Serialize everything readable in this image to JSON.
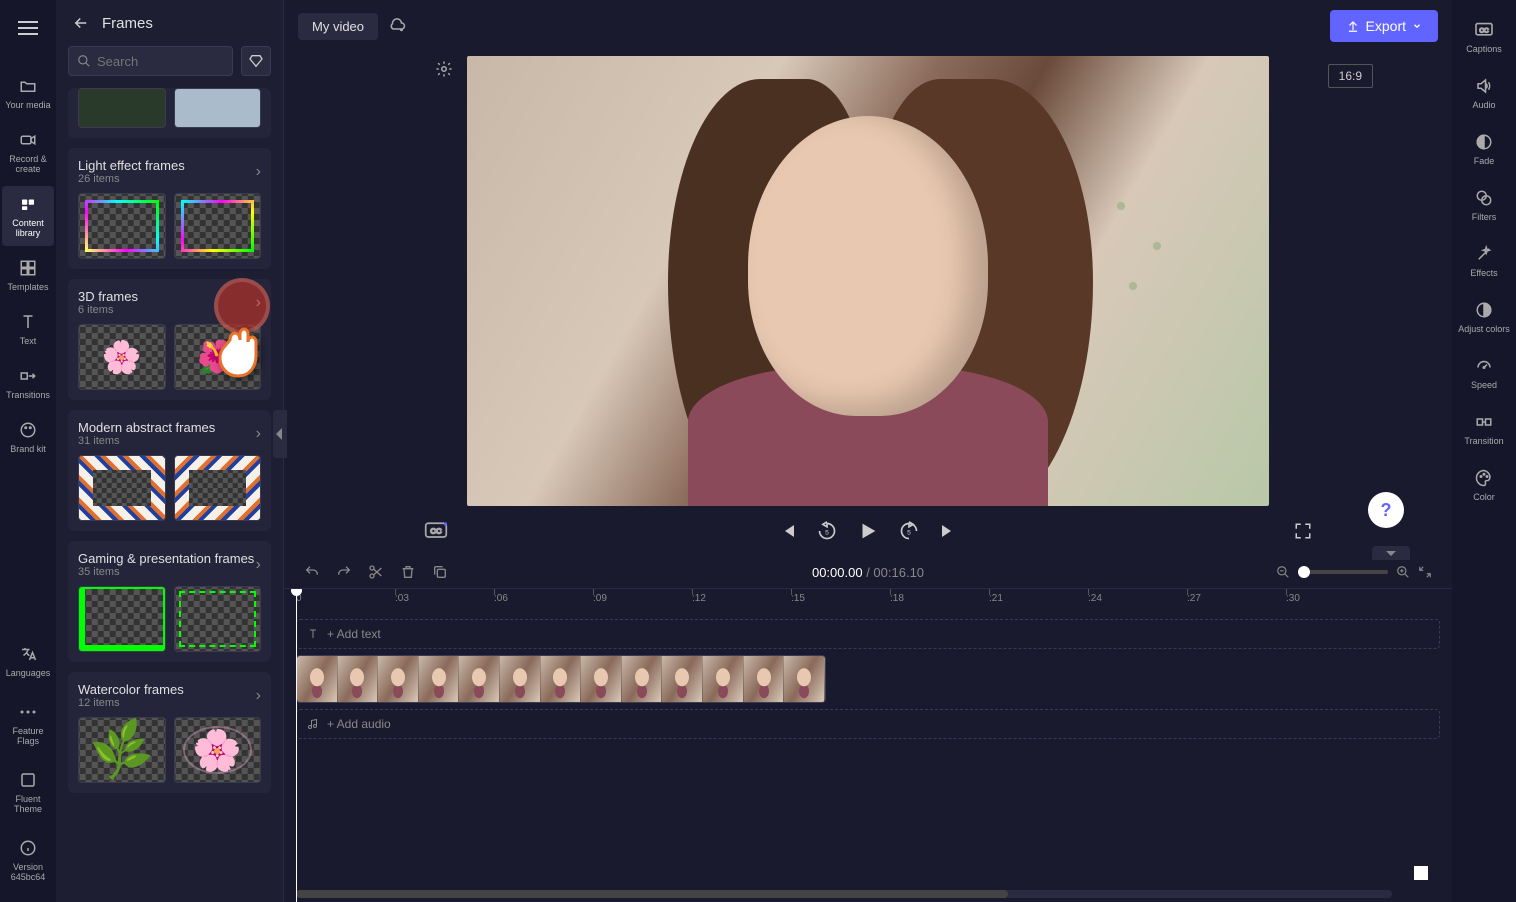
{
  "nav": {
    "items": [
      {
        "label": "Your media"
      },
      {
        "label": "Record & create"
      },
      {
        "label": "Content library"
      },
      {
        "label": "Templates"
      },
      {
        "label": "Text"
      },
      {
        "label": "Transitions"
      },
      {
        "label": "Brand kit"
      }
    ],
    "bottom": [
      {
        "label": "Languages"
      },
      {
        "label": "Feature Flags"
      },
      {
        "label": "Fluent Theme"
      },
      {
        "label": "Version 645bc64"
      }
    ]
  },
  "panel": {
    "title": "Frames",
    "search_placeholder": "Search",
    "categories": [
      {
        "title": "Light effect frames",
        "count": "26 items"
      },
      {
        "title": "3D frames",
        "count": "6 items"
      },
      {
        "title": "Modern abstract frames",
        "count": "31 items"
      },
      {
        "title": "Gaming & presentation frames",
        "count": "35 items"
      },
      {
        "title": "Watercolor frames",
        "count": "12 items"
      }
    ]
  },
  "top": {
    "project_name": "My video",
    "export_label": "Export"
  },
  "preview": {
    "aspect": "16:9"
  },
  "timeline": {
    "current": "00:00.00",
    "duration": "00:16.10",
    "add_text": "+ Add text",
    "add_audio": "+ Add audio",
    "ticks": [
      "0",
      ":03",
      ":06",
      ":09",
      ":12",
      ":15",
      ":18",
      ":21",
      ":24",
      ":27",
      ":30"
    ]
  },
  "right": {
    "items": [
      {
        "label": "Captions"
      },
      {
        "label": "Audio"
      },
      {
        "label": "Fade"
      },
      {
        "label": "Filters"
      },
      {
        "label": "Effects"
      },
      {
        "label": "Adjust colors"
      },
      {
        "label": "Speed"
      },
      {
        "label": "Transition"
      },
      {
        "label": "Color"
      }
    ]
  }
}
